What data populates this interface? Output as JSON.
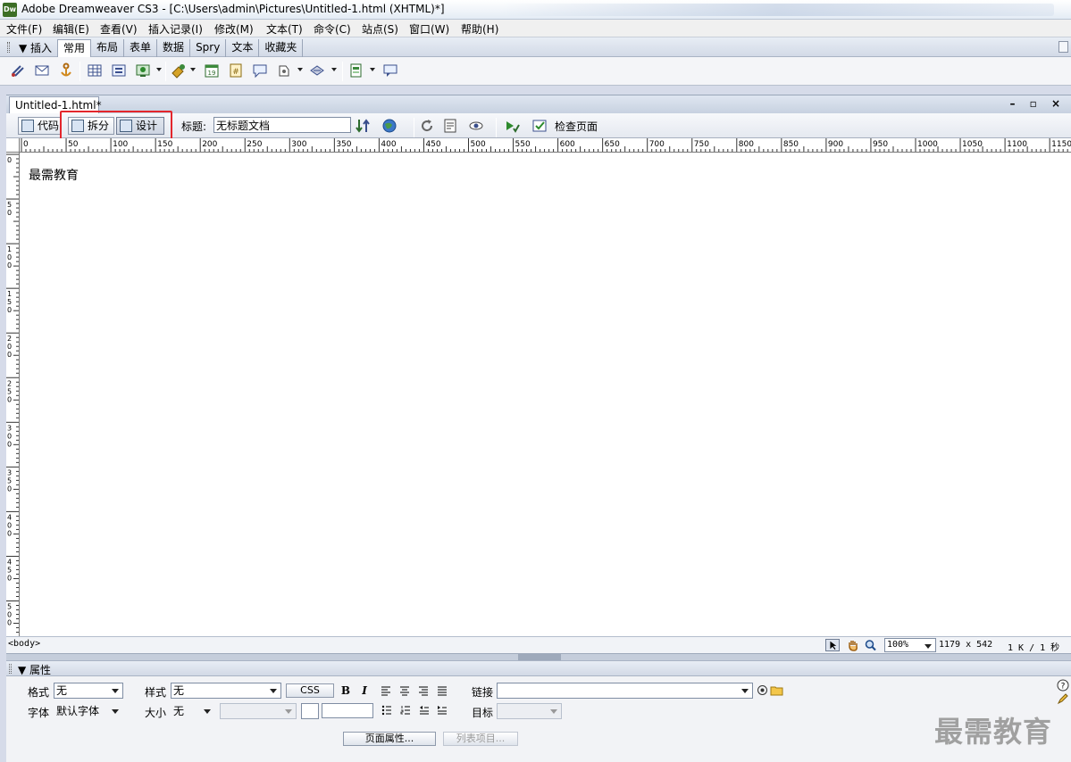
{
  "window": {
    "app_icon_text": "Dw",
    "title": "Adobe Dreamweaver CS3 - [C:\\Users\\admin\\Pictures\\Untitled-1.html (XHTML)*]"
  },
  "menu": [
    "文件(F)",
    "编辑(E)",
    "查看(V)",
    "插入记录(I)",
    "修改(M)",
    "文本(T)",
    "命令(C)",
    "站点(S)",
    "窗口(W)",
    "帮助(H)"
  ],
  "insert_panel": {
    "label": "▼ 插入",
    "tabs": [
      "常用",
      "布局",
      "表单",
      "数据",
      "Spry",
      "文本",
      "收藏夹"
    ],
    "active_tab": "常用"
  },
  "document": {
    "tab_title": "Untitled-1.html*",
    "window_controls": "– ▫ ×",
    "views": {
      "code": "代码",
      "split": "拆分",
      "design": "设计"
    },
    "active_view": "设计",
    "title_label": "标题:",
    "title_value": "无标题文档",
    "check_page": "检查页面",
    "content_text": "最需教育"
  },
  "ruler": {
    "h_labels": [
      "0",
      "50",
      "100",
      "150",
      "200",
      "250",
      "300",
      "350",
      "400",
      "450",
      "500",
      "550",
      "600",
      "650",
      "700",
      "750",
      "800",
      "850",
      "900",
      "950",
      "1000",
      "1050",
      "1100",
      "1150"
    ],
    "v_labels": [
      "0",
      "50",
      "100",
      "150",
      "200",
      "250",
      "300",
      "350",
      "400",
      "450",
      "500"
    ]
  },
  "status": {
    "tag": "<body>",
    "zoom": "100%",
    "window_size": "1179 x 542",
    "download": "1 K / 1 秒"
  },
  "properties": {
    "label": "▼ 属性",
    "format_label": "格式",
    "format_value": "无",
    "style_label": "样式",
    "style_value": "无",
    "css_button": "CSS",
    "link_label": "链接",
    "link_value": "",
    "font_label": "字体",
    "font_value": "默认字体",
    "size_label": "大小",
    "size_value": "无",
    "target_label": "目标",
    "page_props_button": "页面属性...",
    "list_item_button": "列表项目..."
  },
  "watermark": "最需教育",
  "colors": {
    "highlight_box": "#e3262c",
    "panel_bg": "#d6dbe9",
    "canvas_bg": "#ffffff"
  }
}
